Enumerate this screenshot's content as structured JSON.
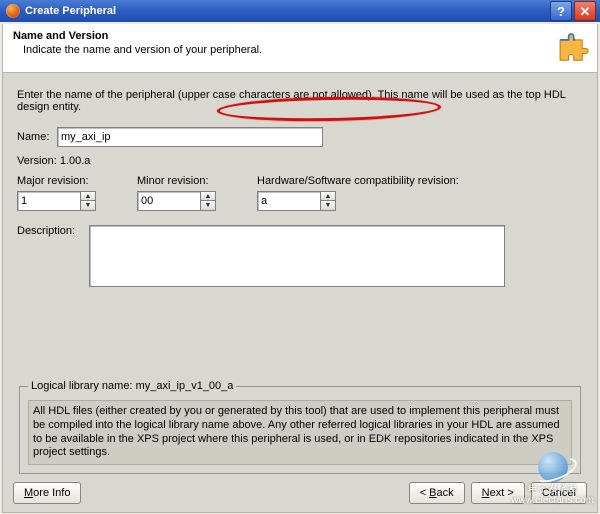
{
  "window": {
    "title": "Create Peripheral"
  },
  "header": {
    "title": "Name and Version",
    "subtitle": "Indicate the name and version of your peripheral."
  },
  "prompt": {
    "before": "Enter the name of the peripheral ",
    "highlight": "(upper case characters are not allowed).",
    "after": " This name will be used as the top HDL design entity."
  },
  "fields": {
    "name_label": "Name:",
    "name_value": "my_axi_ip",
    "version_label": "Version:",
    "version_value": "1.00.a",
    "major_label": "Major revision:",
    "major_value": "1",
    "minor_label": "Minor revision:",
    "minor_value": "00",
    "compat_label": "Hardware/Software compatibility revision:",
    "compat_value": "a",
    "description_label": "Description:",
    "description_value": ""
  },
  "library": {
    "legend_prefix": "Logical library name: ",
    "legend_name": "my_axi_ip_v1_00_a",
    "text": "All HDL files (either created by you or generated by this tool) that are used to implement this peripheral must be compiled into the logical library name above. Any other referred logical libraries in your HDL are assumed to be available in the XPS project where this peripheral is used, or in EDK repositories indicated in the XPS project settings."
  },
  "buttons": {
    "more_info": "More Info",
    "back": "< Back",
    "next": "Next >",
    "cancel": "Cancel"
  },
  "watermark": {
    "line1": "电子发烧友",
    "line2": "www.elecfans.com"
  }
}
